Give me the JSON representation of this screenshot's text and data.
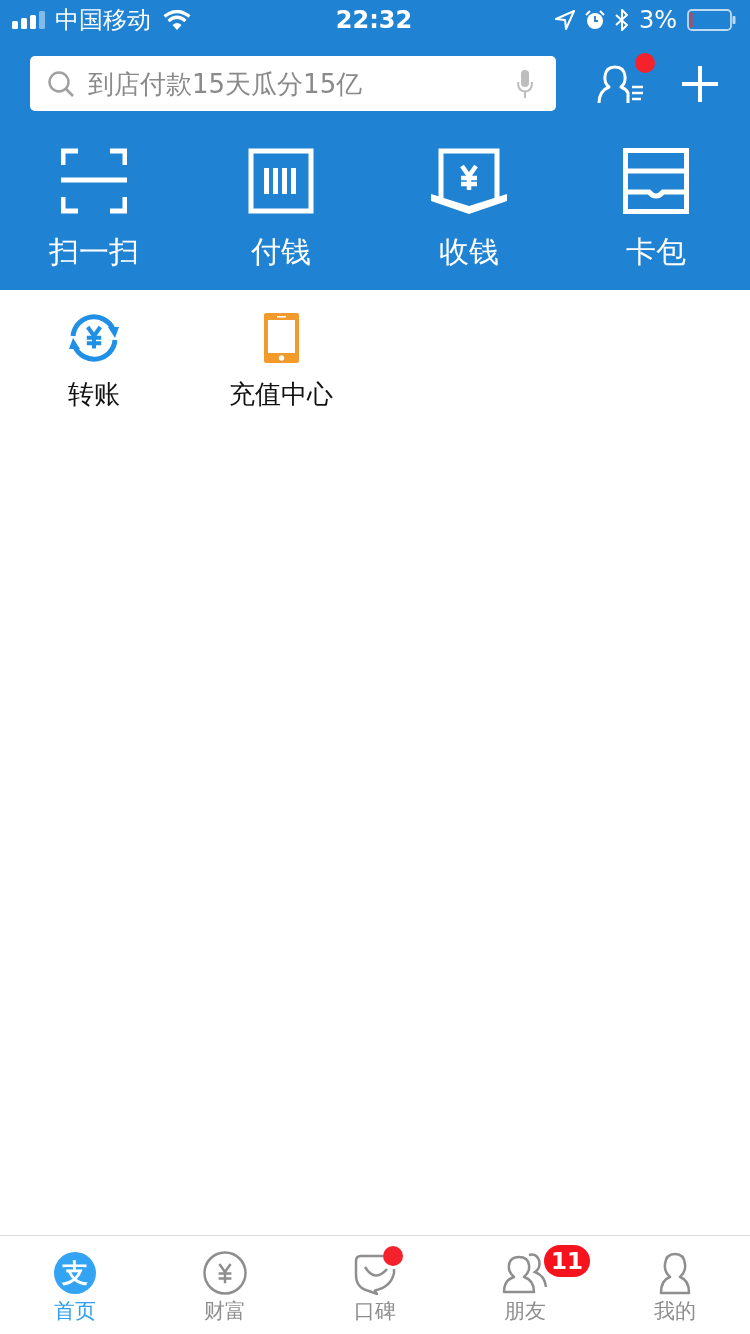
{
  "status_bar": {
    "carrier": "中国移动",
    "time": "22:32",
    "battery": "3%"
  },
  "search": {
    "placeholder": "到店付款15天瓜分15亿"
  },
  "contacts": {
    "dot": true
  },
  "quick_actions": [
    {
      "kind": "scan",
      "label": "扫一扫"
    },
    {
      "kind": "pay",
      "label": "付钱"
    },
    {
      "kind": "collect",
      "label": "收钱"
    },
    {
      "kind": "cards",
      "label": "卡包"
    }
  ],
  "apps": [
    {
      "kind": "transfer",
      "label": "转账"
    },
    {
      "kind": "topup",
      "label": "充值中心"
    }
  ],
  "tab_bar": [
    {
      "kind": "home",
      "label": "首页",
      "logo": "支",
      "selected": true,
      "dot": false
    },
    {
      "kind": "wealth",
      "label": "财富",
      "selected": false,
      "dot": false
    },
    {
      "kind": "koubei",
      "label": "口碑",
      "selected": false,
      "dot": true
    },
    {
      "kind": "friends",
      "label": "朋友",
      "selected": false,
      "dot": false,
      "badge": "11"
    },
    {
      "kind": "me",
      "label": "我的",
      "selected": false,
      "dot": false
    }
  ]
}
